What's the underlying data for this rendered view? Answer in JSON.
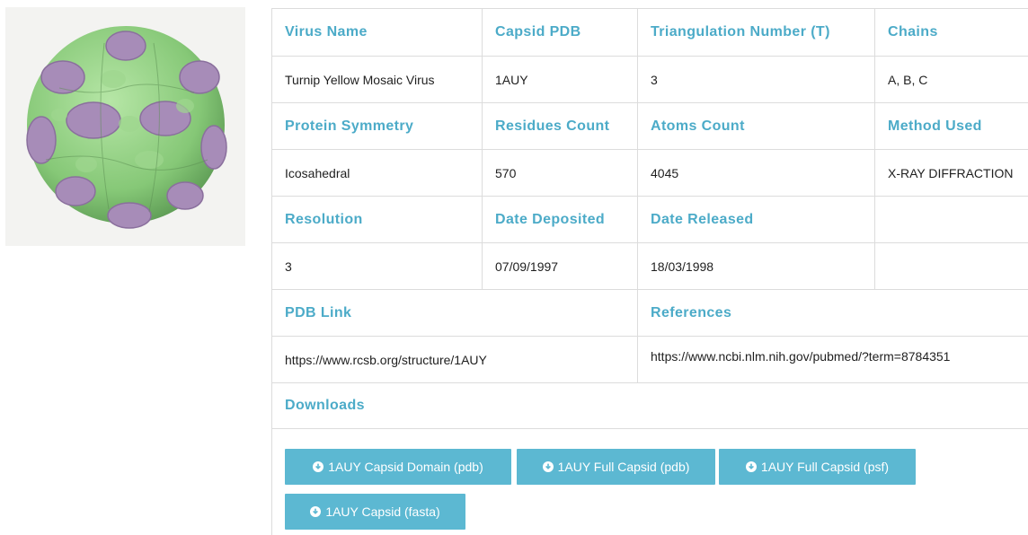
{
  "rows": [
    {
      "headers": [
        "Virus Name",
        "Capsid PDB",
        "Triangulation Number (T)",
        "Chains"
      ],
      "values": [
        "Turnip Yellow Mosaic Virus",
        "1AUY",
        "3",
        "A, B, C"
      ]
    },
    {
      "headers": [
        "Protein Symmetry",
        "Residues Count",
        "Atoms Count",
        "Method Used"
      ],
      "values": [
        "Icosahedral",
        "570",
        "4045",
        "X-RAY DIFFRACTION"
      ]
    },
    {
      "headers": [
        "Resolution",
        "Date Deposited",
        "Date Released",
        ""
      ],
      "values": [
        "3",
        "07/09/1997",
        "18/03/1998",
        ""
      ]
    }
  ],
  "links": {
    "pdb_header": "PDB Link",
    "pdb_url": "https://www.rcsb.org/structure/1AUY",
    "ref_header": "References",
    "ref_url": "https://www.ncbi.nlm.nih.gov/pubmed/?term=8784351"
  },
  "downloads": {
    "header": "Downloads",
    "buttons": [
      "1AUY Capsid Domain (pdb)",
      "1AUY Full Capsid (pdb)",
      "1AUY Full Capsid (psf)",
      "1AUY Capsid (fasta)"
    ],
    "button_icon": "download-circle-icon"
  },
  "image": {
    "subject": "virus-capsid-3d-render",
    "colors": {
      "background": "#f3f3f1",
      "primary": "#8fcf7f",
      "secondary": "#a78cb8"
    }
  },
  "colors": {
    "header_text": "#4cabc8",
    "button_bg": "#5cb8d2",
    "border": "#dcdcdc"
  }
}
